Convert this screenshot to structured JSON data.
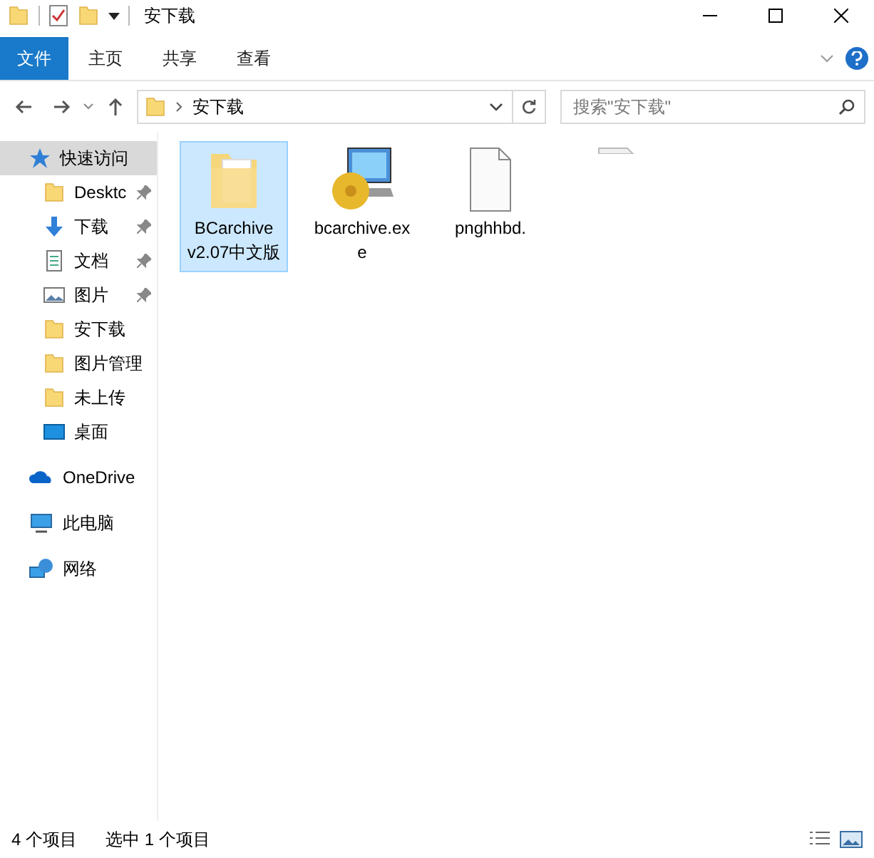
{
  "window": {
    "title": "安下载"
  },
  "ribbon_tabs": [
    {
      "label": "文件",
      "selected": true
    },
    {
      "label": "主页",
      "selected": false
    },
    {
      "label": "共享",
      "selected": false
    },
    {
      "label": "查看",
      "selected": false
    }
  ],
  "address": {
    "path": "安下载"
  },
  "search": {
    "placeholder": "搜索\"安下载\""
  },
  "nav": [
    {
      "label": "快速访问",
      "kind": "quick",
      "selected": true,
      "children": [
        {
          "label": "Desktc",
          "kind": "folder",
          "pinned": true
        },
        {
          "label": "下载",
          "kind": "download",
          "pinned": true
        },
        {
          "label": "文档",
          "kind": "docs",
          "pinned": true
        },
        {
          "label": "图片",
          "kind": "pictures",
          "pinned": true
        },
        {
          "label": "安下载",
          "kind": "folder",
          "pinned": false
        },
        {
          "label": "图片管理",
          "kind": "folder",
          "pinned": false
        },
        {
          "label": "未上传",
          "kind": "folder",
          "pinned": false
        },
        {
          "label": "桌面",
          "kind": "desktop",
          "pinned": false
        }
      ]
    },
    {
      "label": "OneDrive",
      "kind": "cloud",
      "selected": false
    },
    {
      "label": "此电脑",
      "kind": "pc",
      "selected": false
    },
    {
      "label": "网络",
      "kind": "network",
      "selected": false
    }
  ],
  "files": [
    {
      "name": "BCarchive v2.07中文版",
      "kind": "folder",
      "selected": true
    },
    {
      "name": "bcarchive.exe",
      "kind": "exe",
      "selected": false
    },
    {
      "name": "pnghhbd.",
      "kind": "file",
      "selected": false
    },
    {
      "kind": "partial",
      "selected": false
    }
  ],
  "status_bar": {
    "count": "4 个项目",
    "selection": "选中 1 个项目"
  }
}
